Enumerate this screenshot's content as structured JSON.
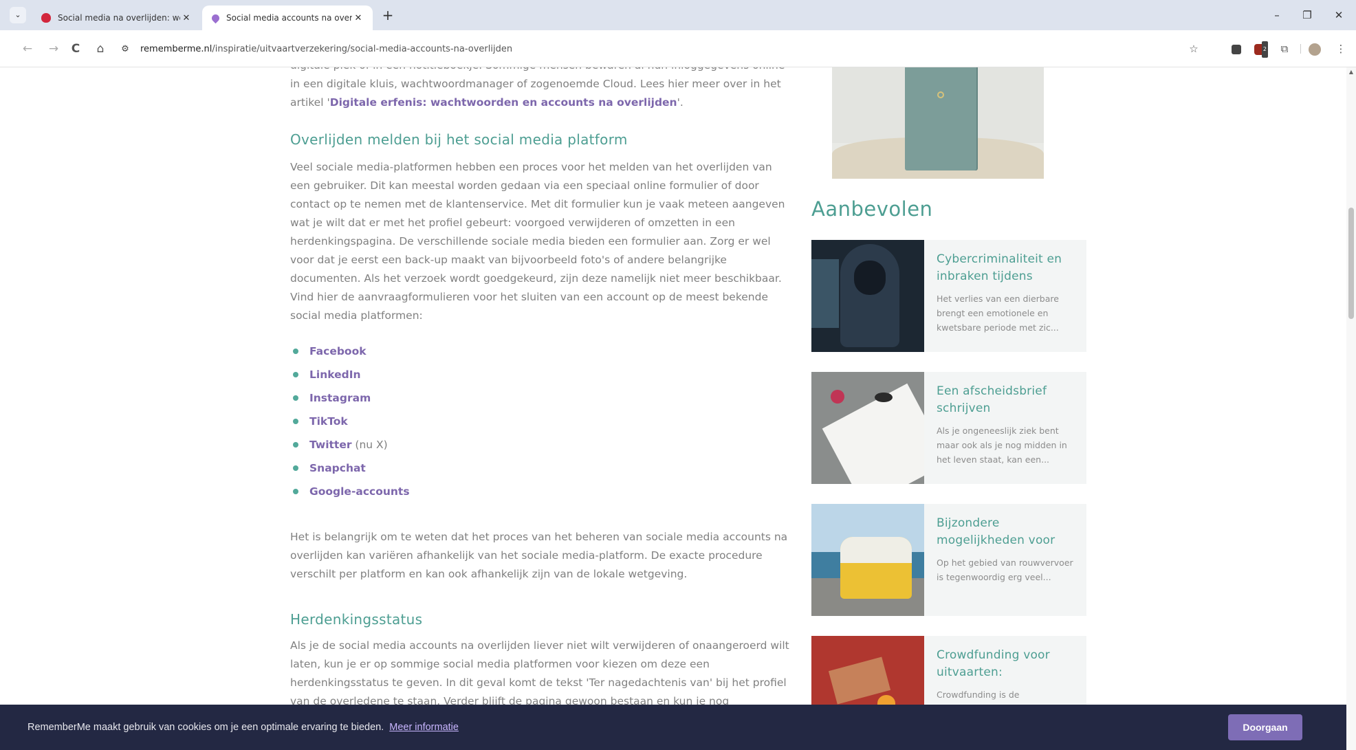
{
  "browser": {
    "tabs": [
      {
        "title": "Social media na overlijden: wel"
      },
      {
        "title": "Social media accounts na overl"
      }
    ],
    "url_host": "rememberme.nl",
    "url_path": "/inspiratie/uitvaartverzekering/social-media-accounts-na-overlijden",
    "controls": {
      "menu": "⌄",
      "close": "✕",
      "new_tab": "+",
      "minimize": "–",
      "restore": "❐",
      "window_close": "✕",
      "back": "←",
      "forward": "→",
      "reload": "C",
      "home": "⌂",
      "site_info": "⚙",
      "bookmark": "☆",
      "extensions": "⧉",
      "more": "⋮"
    },
    "extension_badge": "2"
  },
  "article": {
    "intro_prefix": "digitale plek of in een notitieboekje. Sommige mensen bewaren al hun inloggegevens online in een digitale kluis, wachtwoordmanager of zogenoemde Cloud. Lees hier meer over in het artikel '",
    "intro_link": "Digitale erfenis: wachtwoorden en accounts na overlijden",
    "intro_suffix": "'.",
    "section1_heading": "Overlijden melden bij het social media platform",
    "section1_body": "Veel sociale media-platformen hebben een proces voor het melden van het overlijden van een gebruiker. Dit kan meestal worden gedaan via een speciaal online formulier of door contact op te nemen met de klantenservice. Met dit formulier kun je vaak meteen aangeven wat je wilt dat er met het profiel gebeurt: voorgoed verwijderen of omzetten in een herdenkingspagina. De verschillende sociale media bieden een formulier aan. Zorg er wel voor dat je eerst een back-up maakt van bijvoorbeeld foto's of andere belangrijke documenten. Als het verzoek wordt goedgekeurd, zijn deze namelijk niet meer beschikbaar. Vind hier de aanvraagformulieren voor het sluiten van een account op de meest bekende social media platformen:",
    "platforms": [
      "Facebook",
      "LinkedIn",
      "Instagram",
      "TikTok",
      "Twitter",
      "Snapchat",
      "Google-accounts"
    ],
    "twitter_note": " (nu X)",
    "section1_outro": "Het is belangrijk om te weten dat het proces van het beheren van sociale media accounts na overlijden kan variëren afhankelijk van het sociale media-platform. De exacte procedure verschilt per platform en kan ook afhankelijk zijn van de lokale wetgeving.",
    "section2_heading": "Herdenkingsstatus",
    "section2_body": "Als je de social media accounts na overlijden liever niet wilt verwijderen of onaangeroerd wilt laten, kun je er op sommige social media platformen voor kiezen om deze een herdenkingsstatus te geven. In dit geval komt de tekst 'Ter nagedachtenis van' bij het profiel van de overledene te staan. Verder blijft de pagina gewoon bestaan en kun je nog"
  },
  "sidebar": {
    "heading": "Aanbevolen",
    "cards": [
      {
        "title": "Cybercriminaliteit en inbraken tijdens",
        "excerpt": "Het verlies van een dierbare brengt een emotionele en kwetsbare periode met zic..."
      },
      {
        "title": "Een afscheidsbrief schrijven",
        "excerpt": "Als je ongeneeslijk ziek bent maar ook als je nog midden in het leven staat, kan een..."
      },
      {
        "title": "Bijzondere mogelijkheden voor",
        "excerpt": "Op het gebied van rouwvervoer is tegenwoordig erg veel..."
      },
      {
        "title": "Crowdfunding voor uitvaarten:",
        "excerpt": "Crowdfunding is de"
      }
    ]
  },
  "cookie": {
    "text": "RememberMe maakt gebruik van cookies om je een optimale ervaring te bieden.",
    "link": "Meer informatie",
    "button": "Doorgaan"
  },
  "colors": {
    "accent_green": "#4d9e92",
    "link_purple": "#7d67ac",
    "cookie_bg": "#232843",
    "cookie_button": "#7e6db6"
  }
}
